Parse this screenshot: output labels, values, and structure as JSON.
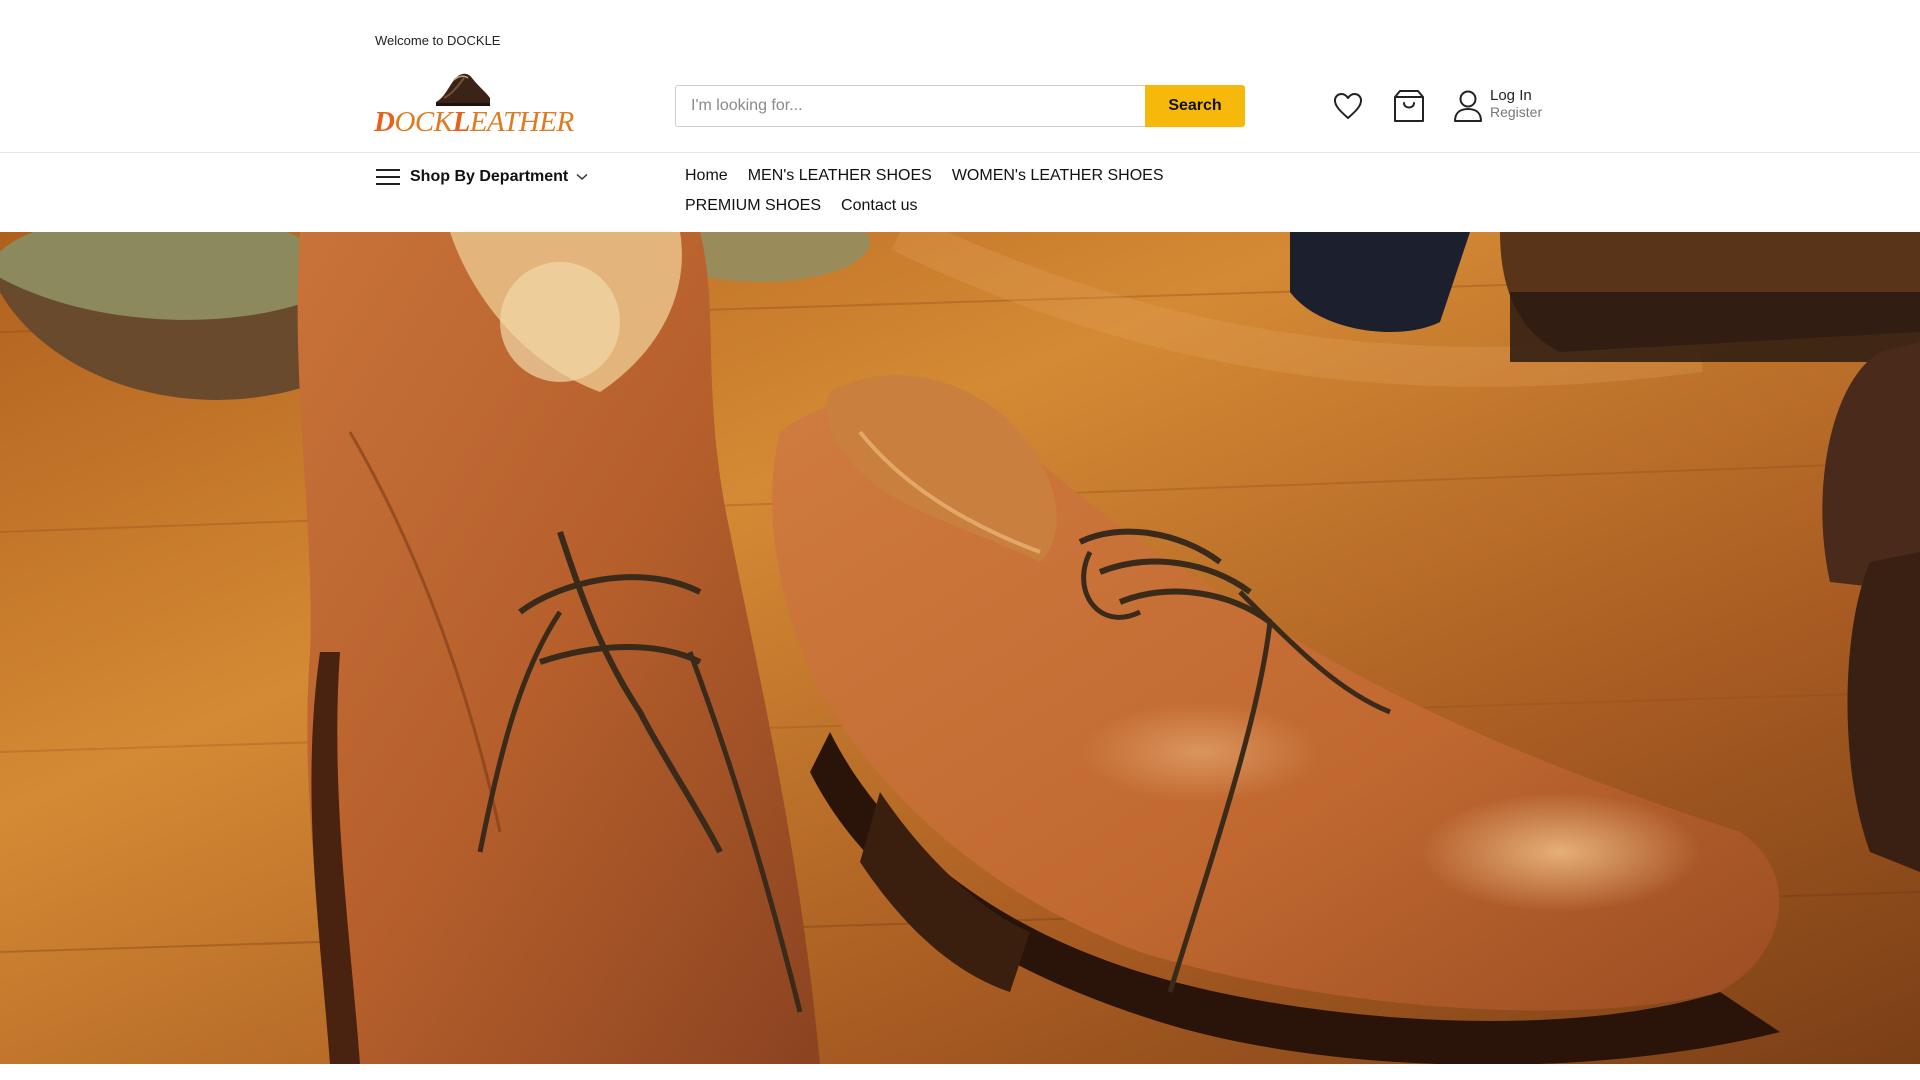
{
  "topbar": {
    "welcome": "Welcome to DOCKLE"
  },
  "logo": {
    "text": "DOCK LEATHER",
    "brand_color": "#e07a1f"
  },
  "search": {
    "placeholder": "I'm looking for...",
    "value": "",
    "button_label": "Search",
    "button_color": "#f6b80b"
  },
  "header_icons": {
    "wishlist": "heart-icon",
    "cart": "shopping-bag-icon",
    "account": "user-icon"
  },
  "account": {
    "login_label": "Log In",
    "register_label": "Register"
  },
  "nav": {
    "department_label": "Shop By Department",
    "menu": [
      {
        "label": "Home"
      },
      {
        "label": "MEN's LEATHER SHOES"
      },
      {
        "label": "WOMEN's LEATHER SHOES"
      },
      {
        "label": "PREMIUM SHOES"
      },
      {
        "label": "Contact us"
      }
    ]
  },
  "hero": {
    "subject": "brown leather derby shoes on wooden floor"
  }
}
